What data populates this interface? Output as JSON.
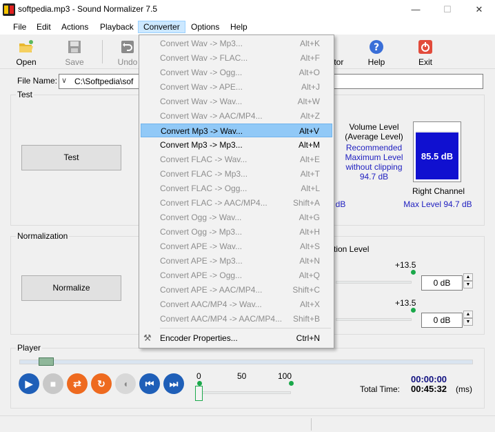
{
  "window": {
    "title": "softpedia.mp3 - Sound Normalizer 7.5",
    "controls": {
      "minimize": "—",
      "maximize": "☐",
      "close": "✕"
    }
  },
  "menu": [
    "File",
    "Edit",
    "Actions",
    "Playback",
    "Converter",
    "Options",
    "Help"
  ],
  "toolbar": {
    "open": "Open",
    "save": "Save",
    "undo": "Undo",
    "editor": "itor",
    "help": "Help",
    "exit": "Exit"
  },
  "file": {
    "label": "File Name:",
    "value": "C:\\Softpedia\\sof"
  },
  "test": {
    "group_label": "Test",
    "button": "Test",
    "volume_title": "Volume Level",
    "volume_sub": "(Average Level)",
    "recommended_1": "Recommended",
    "recommended_2": "Maximum Level",
    "recommended_3": "without clipping",
    "recommended_value": "94.7 dB",
    "meter_value": "85.5 dB",
    "meter_fill": 0.88,
    "channel": "Right Channel",
    "max_level": "Max Level 94.7 dB",
    "left_fragment": "dB"
  },
  "normalization": {
    "group_label": "Normalization",
    "button": "Normalize",
    "level_label": "tion Level",
    "row1": {
      "max": "+13.5",
      "value": "0 dB"
    },
    "row2": {
      "max": "+13.5",
      "value": "0 dB"
    }
  },
  "player": {
    "group_label": "Player",
    "scale": [
      "0",
      "50",
      "100"
    ],
    "current_time": "00:00:00",
    "total_label": "Total Time:",
    "total_time": "00:45:32",
    "unit": "(ms)"
  },
  "converter_menu": [
    {
      "label": "Convert Wav -> Mp3...",
      "shortcut": "Alt+K",
      "enabled": false
    },
    {
      "label": "Convert Wav -> FLAC...",
      "shortcut": "Alt+F",
      "enabled": false
    },
    {
      "label": "Convert Wav -> Ogg...",
      "shortcut": "Alt+O",
      "enabled": false
    },
    {
      "label": "Convert Wav -> APE...",
      "shortcut": "Alt+J",
      "enabled": false
    },
    {
      "label": "Convert Wav -> Wav...",
      "shortcut": "Alt+W",
      "enabled": false
    },
    {
      "label": "Convert Wav -> AAC/MP4...",
      "shortcut": "Alt+Z",
      "enabled": false
    },
    {
      "label": "Convert Mp3 -> Wav...",
      "shortcut": "Alt+V",
      "enabled": true,
      "highlighted": true
    },
    {
      "label": "Convert Mp3 -> Mp3...",
      "shortcut": "Alt+M",
      "enabled": true
    },
    {
      "label": "Convert FLAC -> Wav...",
      "shortcut": "Alt+E",
      "enabled": false
    },
    {
      "label": "Convert FLAC -> Mp3...",
      "shortcut": "Alt+T",
      "enabled": false
    },
    {
      "label": "Convert FLAC -> Ogg...",
      "shortcut": "Alt+L",
      "enabled": false
    },
    {
      "label": "Convert FLAC -> AAC/MP4...",
      "shortcut": "Shift+A",
      "enabled": false
    },
    {
      "label": "Convert Ogg -> Wav...",
      "shortcut": "Alt+G",
      "enabled": false
    },
    {
      "label": "Convert Ogg -> Mp3...",
      "shortcut": "Alt+H",
      "enabled": false
    },
    {
      "label": "Convert APE -> Wav...",
      "shortcut": "Alt+S",
      "enabled": false
    },
    {
      "label": "Convert APE -> Mp3...",
      "shortcut": "Alt+N",
      "enabled": false
    },
    {
      "label": "Convert APE -> Ogg...",
      "shortcut": "Alt+Q",
      "enabled": false
    },
    {
      "label": "Convert APE -> AAC/MP4...",
      "shortcut": "Shift+C",
      "enabled": false
    },
    {
      "label": "Convert AAC/MP4 -> Wav...",
      "shortcut": "Alt+X",
      "enabled": false
    },
    {
      "label": "Convert AAC/MP4 -> AAC/MP4...",
      "shortcut": "Shift+B",
      "enabled": false
    },
    {
      "label": "Encoder Properties...",
      "shortcut": "Ctrl+N",
      "enabled": true
    }
  ]
}
